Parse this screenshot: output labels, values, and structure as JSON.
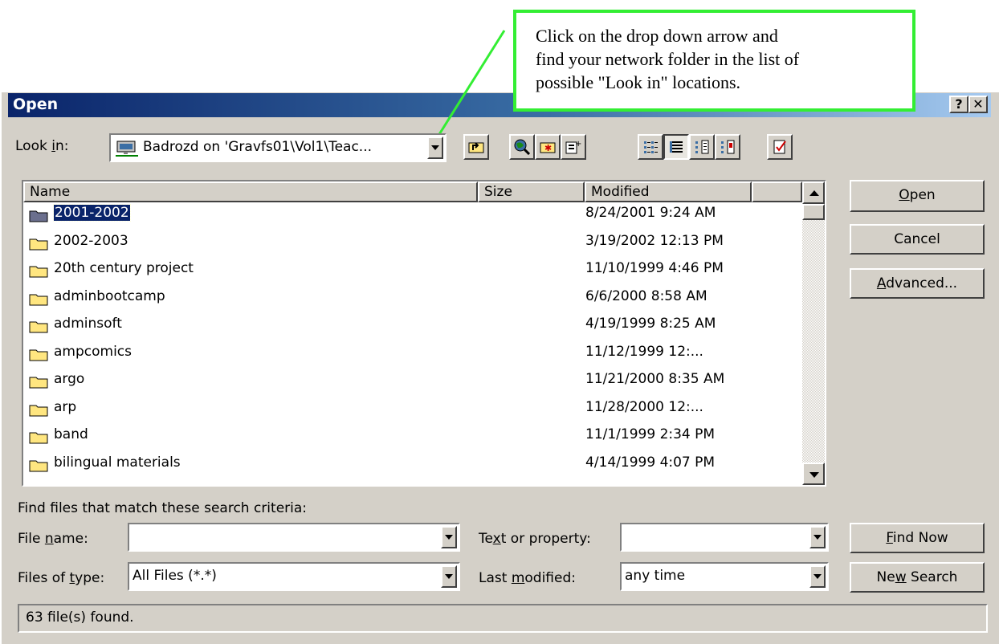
{
  "callout": {
    "line1": "Click on the drop down arrow and",
    "line2": "find your network folder in the list of",
    "line3": "possible \"Look in\" locations.",
    "border_color": "#33ee33"
  },
  "window": {
    "title": "Open",
    "help_label": "?",
    "close_label": "✕"
  },
  "look_in": {
    "label_pre": "Look ",
    "label_u": "i",
    "label_post": "n:",
    "value": "Badrozd on 'Gravfs01\\Vol1\\Teac...",
    "icon": "network-drive-icon"
  },
  "toolbar": {
    "tools": [
      "up-one-level-icon",
      "search-web-icon",
      "create-new-folder-icon",
      "add-to-favorites-icon",
      "list-view-icon",
      "details-view-icon",
      "properties-view-icon",
      "preview-view-icon",
      "commands-and-settings-icon"
    ]
  },
  "file_list": {
    "columns": [
      "Name",
      "Size",
      "Modified"
    ],
    "rows": [
      {
        "name": "2001-2002",
        "modified": "8/24/2001 9:24 AM"
      },
      {
        "name": "2002-2003",
        "modified": "3/19/2002 12:13 PM"
      },
      {
        "name": "20th century project",
        "modified": "11/10/1999 4:46 PM"
      },
      {
        "name": "adminbootcamp",
        "modified": "6/6/2000 8:58 AM"
      },
      {
        "name": "adminsoft",
        "modified": "4/19/1999 8:25 AM"
      },
      {
        "name": "ampcomics",
        "modified": "11/12/1999 12:..."
      },
      {
        "name": "argo",
        "modified": "11/21/2000 8:35 AM"
      },
      {
        "name": "arp",
        "modified": "11/28/2000 12:..."
      },
      {
        "name": "band",
        "modified": "11/1/1999 2:34 PM"
      },
      {
        "name": "bilingual materials",
        "modified": "4/14/1999 4:07 PM"
      }
    ]
  },
  "buttons": {
    "open_u": "O",
    "open_rest": "pen",
    "cancel": "Cancel",
    "advanced_u": "A",
    "advanced_rest": "dvanced...",
    "find_now_u": "F",
    "find_now_rest": "ind Now",
    "new_search_pre": "Ne",
    "new_search_u": "w",
    "new_search_post": " Search"
  },
  "search": {
    "heading": "Find files that match these search criteria:",
    "file_name_pre": "File ",
    "file_name_u": "n",
    "file_name_post": "ame:",
    "file_name_value": "",
    "files_of_type_pre": "Files of ",
    "files_of_type_u": "t",
    "files_of_type_post": "ype:",
    "files_of_type_value": "All Files (*.*)",
    "text_prop_pre": "Te",
    "text_prop_u": "x",
    "text_prop_post": "t or property:",
    "text_prop_value": "",
    "last_mod_pre": "Last ",
    "last_mod_u": "m",
    "last_mod_post": "odified:",
    "last_mod_value": "any time"
  },
  "status": {
    "text": "63 file(s) found."
  }
}
